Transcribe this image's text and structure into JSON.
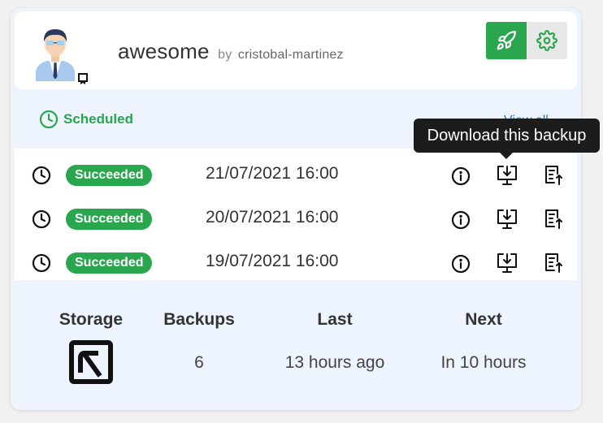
{
  "repo": {
    "name": "awesome",
    "by_label": "by",
    "owner": "cristobal-martinez"
  },
  "header_actions": {
    "launch_icon": "rocket-icon",
    "settings_icon": "gear-icon"
  },
  "schedule": {
    "label": "Scheduled",
    "view_all": "View all"
  },
  "tooltip": {
    "text": "Download this backup"
  },
  "backups": [
    {
      "status": "Succeeded",
      "date": "21/07/2021 16:00"
    },
    {
      "status": "Succeeded",
      "date": "20/07/2021 16:00"
    },
    {
      "status": "Succeeded",
      "date": "19/07/2021 16:00"
    }
  ],
  "stats": {
    "storage": {
      "label": "Storage",
      "icon": "storage-provider-logo"
    },
    "backups": {
      "label": "Backups",
      "value": "6"
    },
    "last": {
      "label": "Last",
      "value": "13 hours ago"
    },
    "next": {
      "label": "Next",
      "value": "In 10 hours"
    }
  },
  "colors": {
    "success": "#2aa64f",
    "link": "#1f6fd1",
    "card_bg": "#edf4fd",
    "tooltip_bg": "#1c1c1c"
  }
}
